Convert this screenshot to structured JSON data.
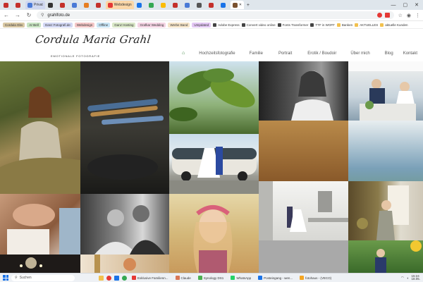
{
  "browser": {
    "tabs": [
      {
        "label": "",
        "color": "#c4302b"
      },
      {
        "label": "",
        "color": "#c4302b"
      },
      {
        "label": "Privat",
        "color": "#4a7ad6"
      },
      {
        "label": "",
        "color": "#333"
      },
      {
        "label": "",
        "color": "#c4302b"
      },
      {
        "label": "",
        "color": "#4a7ad6"
      },
      {
        "label": "",
        "color": "#e67e22"
      },
      {
        "label": "",
        "color": "#c4302b"
      },
      {
        "label": "Webdesign",
        "color": "#e53935"
      }
    ],
    "url": "grahlfoto.de",
    "bookmarks": [
      {
        "label": "Cordula Gbv",
        "color": "#d9c8a4"
      },
      {
        "label": "Ar-Bell",
        "color": "#c7e3c1"
      },
      {
        "label": "Ganz Fotografi.de",
        "color": "#d3d8f4"
      },
      {
        "label": "Webdesign",
        "color": "#f4c7c7"
      },
      {
        "label": "Offline",
        "color": "#c7e3f4"
      },
      {
        "label": "Ganz Hosting",
        "color": "#d9e7c7"
      },
      {
        "label": "Grafkar Wedding",
        "color": "#f4d3e3"
      },
      {
        "label": "Werbe Band",
        "color": "#f4e3c7"
      },
      {
        "label": "Umpdated",
        "color": "#e3c7f4"
      }
    ],
    "bookmarks_plain": [
      "Adobe Express",
      "Convert video online",
      "Fonts Transformer",
      "TTF in WOFF",
      "Banken",
      "AKTUELLES",
      "aktuelle Kunden"
    ]
  },
  "site": {
    "logo_text": "Cordula Maria Grahl",
    "logo_subtitle": "EMOTIONALE FOTOGRAFIE",
    "nav": [
      "Hochzeitsfotografie",
      "Familie",
      "Portrait",
      "Erotik / Boudoir",
      "Über mich",
      "Blog",
      "Kontakt"
    ]
  },
  "taskbar": {
    "search_label": "Suchen",
    "items": [
      {
        "label": "Exklusive Familienn...",
        "color": "#e53935"
      },
      {
        "label": "Claude",
        "color": "#d97757"
      },
      {
        "label": "Synology DS1",
        "color": "#4caf50"
      },
      {
        "label": "WhatsApp",
        "color": "#25d366"
      },
      {
        "label": "Posteingang - wen...",
        "color": "#1a73e8"
      },
      {
        "label": "fotohaus - (VECO)",
        "color": "#f5a623"
      }
    ],
    "time": "15:24",
    "date": "18.05."
  }
}
